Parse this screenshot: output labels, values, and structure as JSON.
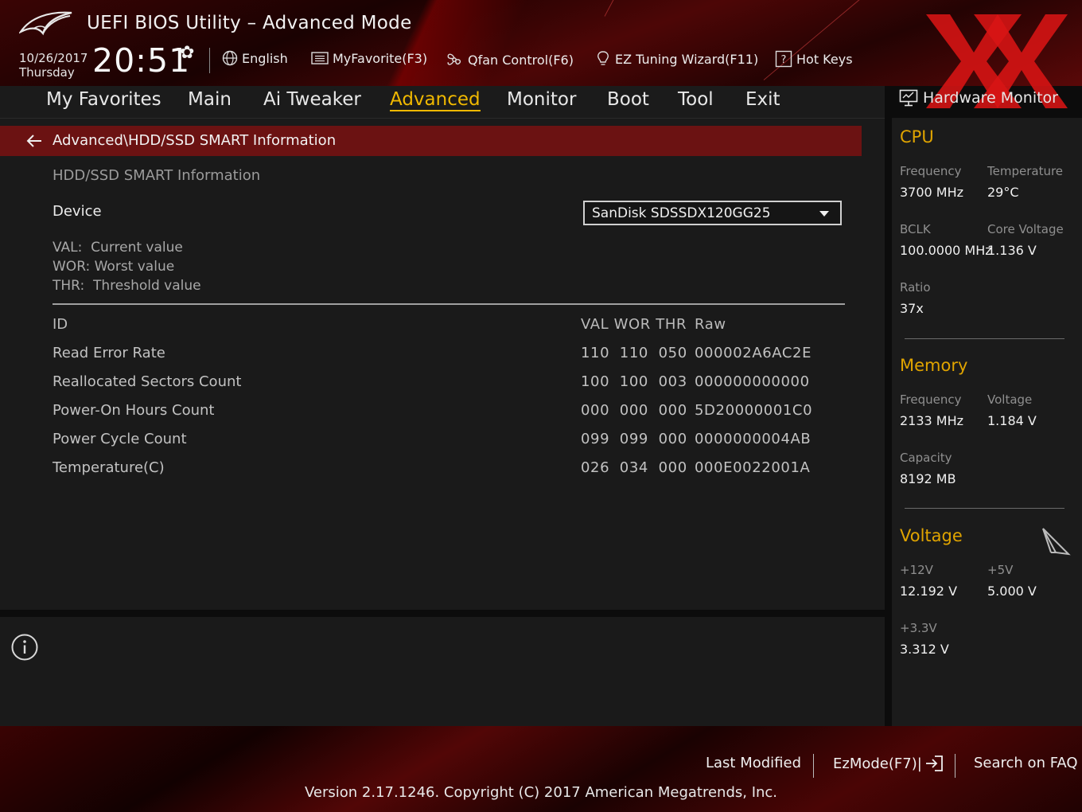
{
  "header": {
    "title": "UEFI BIOS Utility – Advanced Mode",
    "date": "10/26/2017",
    "day": "Thursday",
    "time": "20:51",
    "tools": {
      "language": "English",
      "favorite": "MyFavorite(F3)",
      "qfan": "Qfan Control(F6)",
      "ez_tuning": "EZ Tuning Wizard(F11)",
      "hotkeys": "Hot Keys"
    }
  },
  "nav": {
    "tabs": [
      "My Favorites",
      "Main",
      "Ai Tweaker",
      "Advanced",
      "Monitor",
      "Boot",
      "Tool",
      "Exit"
    ],
    "active": "Advanced"
  },
  "page": {
    "breadcrumb": "Advanced\\HDD/SSD SMART Information",
    "section_title": "HDD/SSD SMART Information",
    "device_label": "Device",
    "device_value": "SanDisk SDSSDX120GG25",
    "legend": [
      "VAL:  Current value",
      "WOR: Worst value",
      "THR:  Threshold value"
    ],
    "table": {
      "headers": {
        "id": "ID",
        "vals": "VAL WOR THR",
        "raw": "Raw"
      },
      "rows": [
        {
          "name": "Read Error Rate",
          "vals": "110  110  050",
          "raw": "000002A6AC2E"
        },
        {
          "name": "Reallocated Sectors Count",
          "vals": "100  100  003",
          "raw": "000000000000"
        },
        {
          "name": "Power-On Hours Count",
          "vals": "000  000  000",
          "raw": "5D20000001C0"
        },
        {
          "name": "Power Cycle Count",
          "vals": "099  099  000",
          "raw": "0000000004AB"
        },
        {
          "name": "Temperature(C)",
          "vals": "026  034  000",
          "raw": "000E0022001A"
        }
      ]
    }
  },
  "hw_monitor": {
    "title": "Hardware Monitor",
    "cpu": {
      "label": "CPU",
      "frequency_label": "Frequency",
      "frequency": "3700 MHz",
      "temperature_label": "Temperature",
      "temperature": "29°C",
      "bclk_label": "BCLK",
      "bclk": "100.0000 MHz",
      "core_voltage_label": "Core Voltage",
      "core_voltage": "1.136 V",
      "ratio_label": "Ratio",
      "ratio": "37x"
    },
    "memory": {
      "label": "Memory",
      "frequency_label": "Frequency",
      "frequency": "2133 MHz",
      "voltage_label": "Voltage",
      "voltage": "1.184 V",
      "capacity_label": "Capacity",
      "capacity": "8192 MB"
    },
    "voltage": {
      "label": "Voltage",
      "v12_label": "+12V",
      "v12": "12.192 V",
      "v5_label": "+5V",
      "v5": "5.000 V",
      "v33_label": "+3.3V",
      "v33": "3.312 V"
    }
  },
  "footer": {
    "last_modified": "Last Modified",
    "ezmode": "EzMode(F7)|",
    "search_faq": "Search on FAQ",
    "version": "Version 2.17.1246. Copyright (C) 2017 American Megatrends, Inc."
  },
  "colors": {
    "accent": "#f0b800",
    "section_label": "#e0a400",
    "breadcrumb_bg": "#6b1212",
    "panel_bg": "#1a1a1a"
  }
}
